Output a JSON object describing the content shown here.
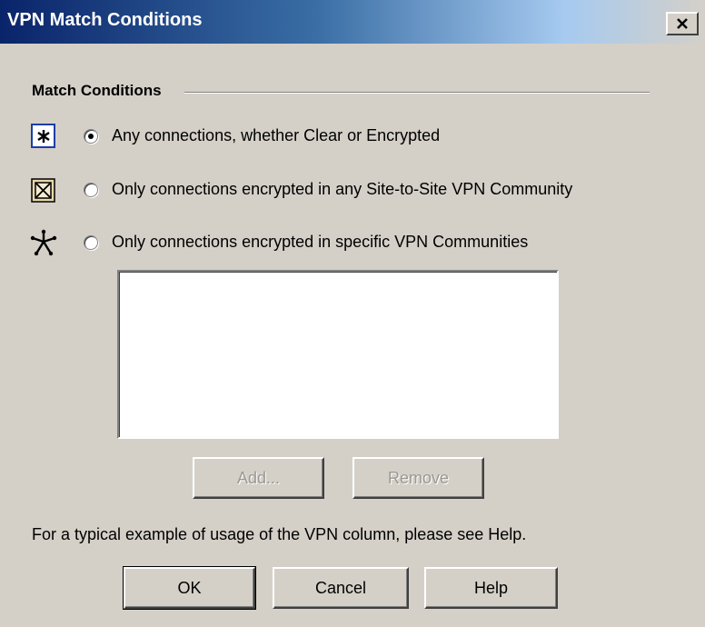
{
  "window": {
    "title": "VPN Match Conditions",
    "close_label": "×"
  },
  "group": {
    "label": "Match Conditions"
  },
  "options": [
    {
      "label": "Any connections, whether Clear or Encrypted",
      "icon": "any-connection-star-icon",
      "selected": true
    },
    {
      "label": "Only connections encrypted in any Site-to-Site VPN Community",
      "icon": "site-to-site-community-icon",
      "selected": false
    },
    {
      "label": "Only connections encrypted in specific VPN Communities",
      "icon": "vpn-community-star-icon",
      "selected": false
    }
  ],
  "communities_list": {
    "items": []
  },
  "list_buttons": {
    "add_label": "Add...",
    "remove_label": "Remove"
  },
  "hint": "For a typical example of usage of the VPN column, please see Help.",
  "footer_buttons": {
    "ok_label": "OK",
    "cancel_label": "Cancel",
    "help_label": "Help"
  },
  "colors": {
    "dialog_bg": "#d4d0c8",
    "titlebar_start": "#0a246a",
    "titlebar_end": "#a6caf0",
    "icon_frame": "#1a3ea8"
  }
}
